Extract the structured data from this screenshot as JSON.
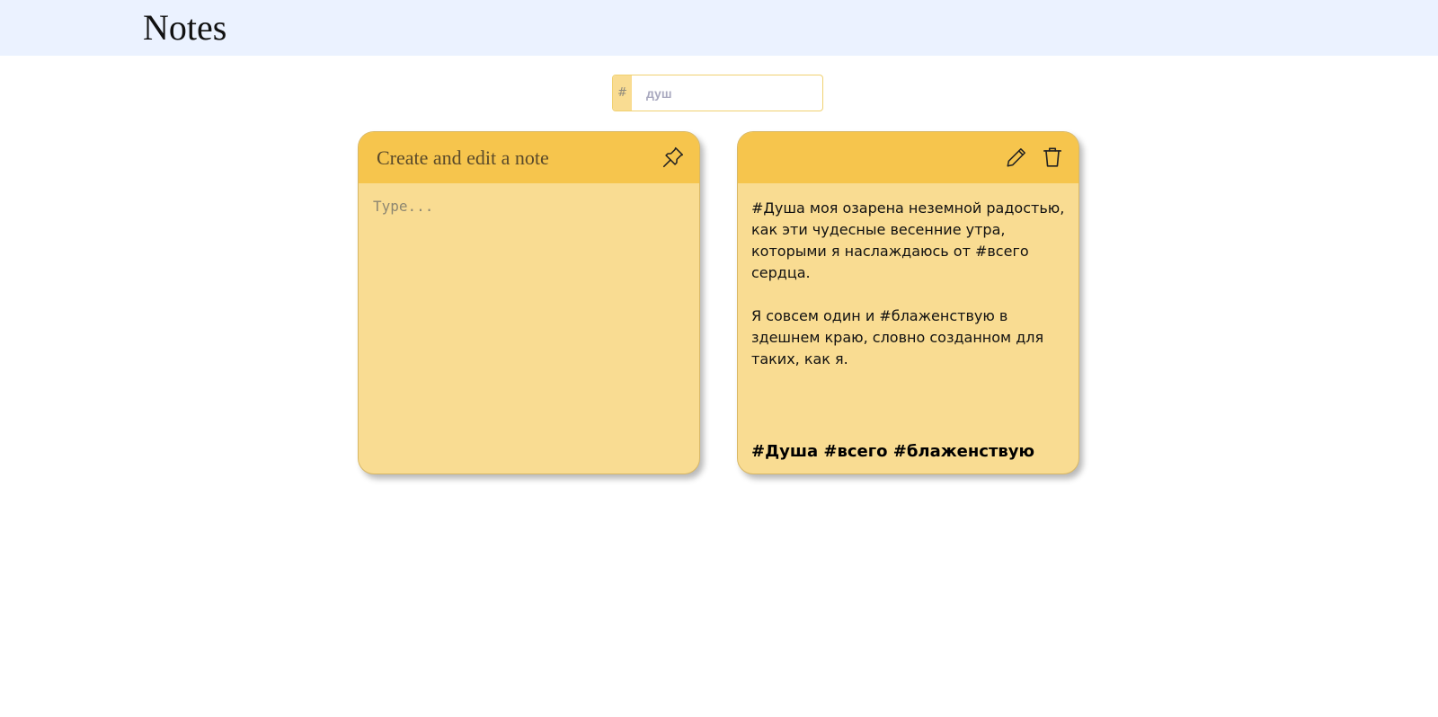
{
  "header": {
    "title": "Notes"
  },
  "search": {
    "prefix": "#",
    "placeholder": "душ"
  },
  "editor": {
    "title": "Create and edit a note",
    "placeholder": "Type...",
    "pin_icon": "pin-icon"
  },
  "notes": [
    {
      "paragraphs": [
        "#Душа моя озарена неземной радостью, как эти чудесные весенние утра, которыми я наслаждаюсь от #всего сердца.",
        "Я совсем один и #блаженствую в здешнем краю, словно созданном для таких, как я."
      ],
      "tags": "#Душа #всего #блаженствую",
      "icons": [
        "pencil-icon",
        "trash-icon"
      ]
    }
  ],
  "colors": {
    "header_bg": "#ebf2ff",
    "note_bg": "#f9dc92",
    "note_header_bg": "#f6c54d"
  }
}
